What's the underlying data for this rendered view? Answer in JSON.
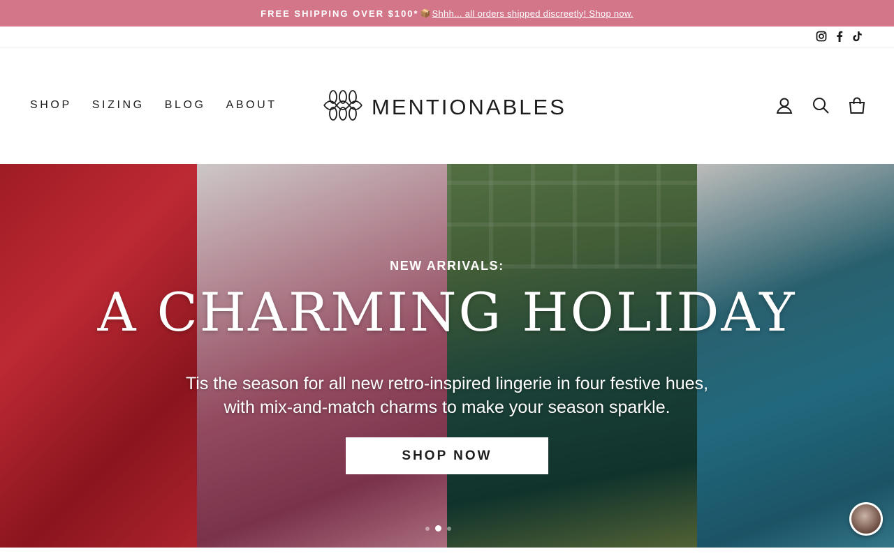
{
  "announcement": {
    "shipping": "FREE SHIPPING OVER $100*",
    "box_glyph": "📦",
    "link_text": "Shhh... all orders shipped discreetly! Shop now."
  },
  "social": [
    "instagram-icon",
    "facebook-icon",
    "tiktok-icon"
  ],
  "nav": [
    {
      "label": "SHOP"
    },
    {
      "label": "SIZING"
    },
    {
      "label": "BLOG"
    },
    {
      "label": "ABOUT"
    }
  ],
  "logo": {
    "text": "MENTIONABLES"
  },
  "header_icons": [
    "user-icon",
    "search-icon",
    "cart-icon"
  ],
  "hero": {
    "kicker": "NEW ARRIVALS:",
    "headline": "A CHARMING HOLIDAY",
    "sub_line1": "Tis the season for all new retro-inspired lingerie in four festive hues,",
    "sub_line2": "with mix-and-match charms to make your season sparkle.",
    "cta": "SHOP NOW",
    "slides": 3,
    "active_slide": 2
  },
  "colors": {
    "announcement_bg": "#d3768a",
    "text": "#1c1c1c"
  }
}
